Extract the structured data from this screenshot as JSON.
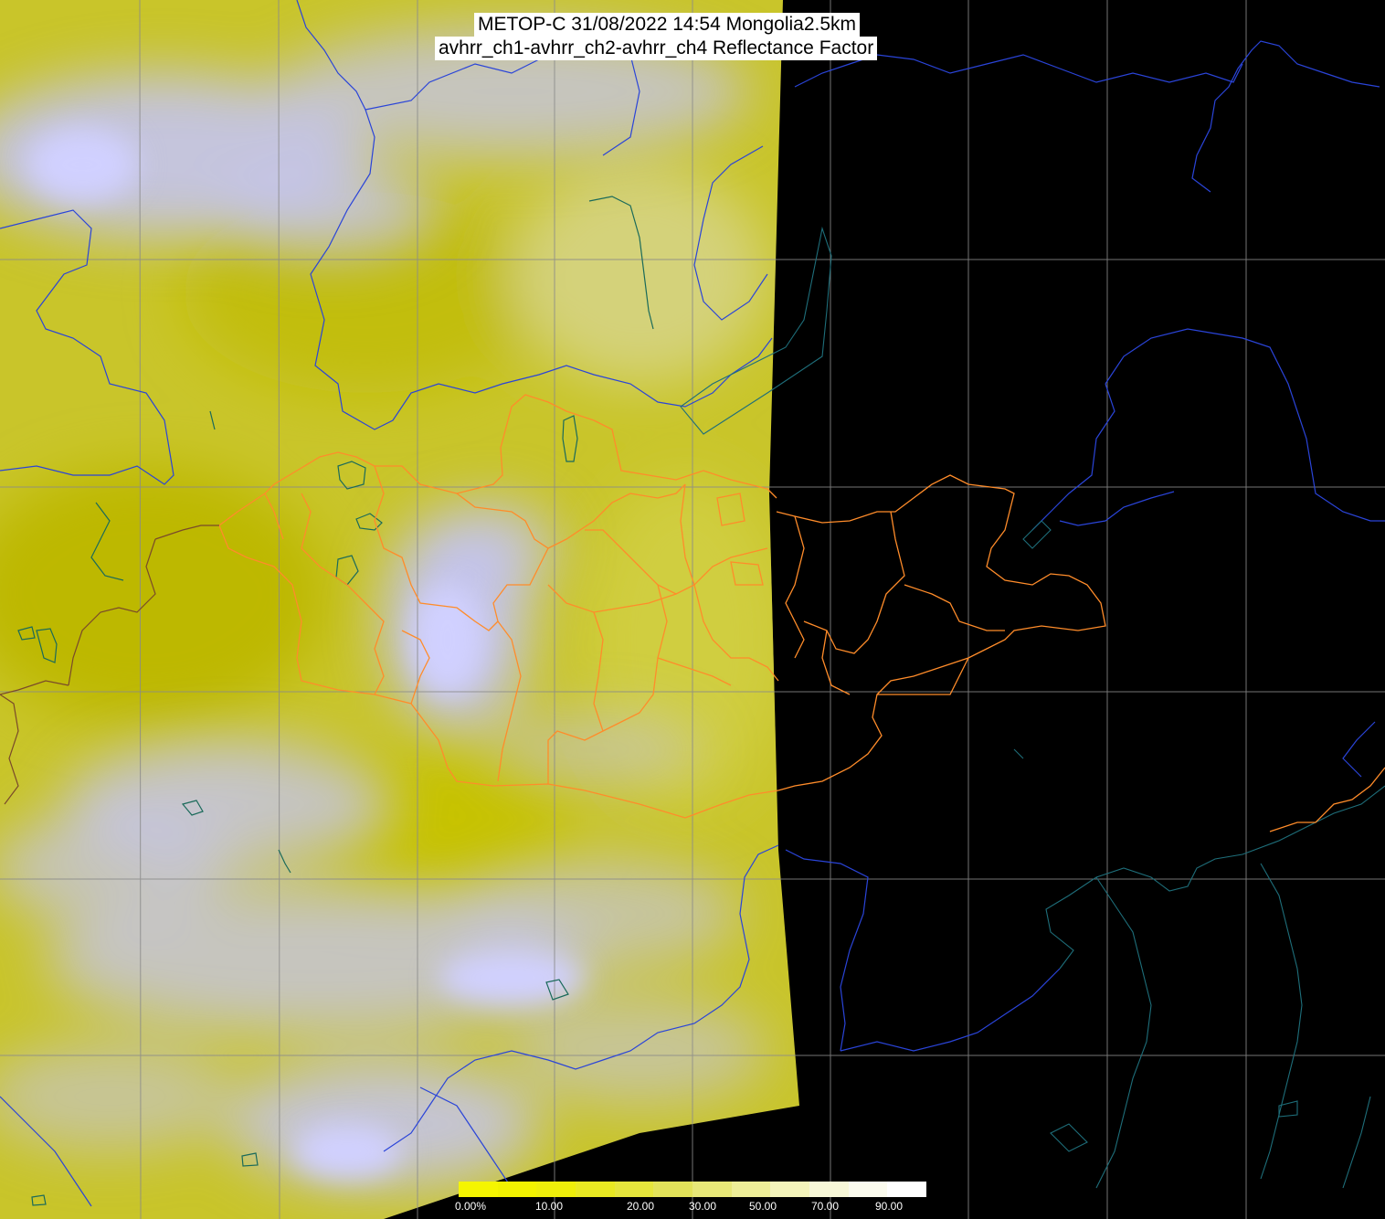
{
  "header": {
    "line1": "METOP-C 31/08/2022 14:54 Mongolia2.5km",
    "line2": "avhrr_ch1-avhrr_ch2-avhrr_ch4 Reflectance Factor"
  },
  "colorbar": {
    "colors": [
      "#f5f500",
      "#f2f200",
      "#eeee0a",
      "#e9e922",
      "#e6e63c",
      "#e3e35a",
      "#e8e878",
      "#eeee98",
      "#f4f4bb",
      "#f8f8d8",
      "#fbfbee",
      "#ffffff"
    ],
    "labels": [
      "0.00%",
      "10.00",
      "20.00",
      "30.00",
      "50.00",
      "70.00",
      "90.00"
    ]
  },
  "colors": {
    "land_yellow": "#c8c400",
    "cloud_lavender": "#c4c4f4",
    "border_orange": "#ff8c2a",
    "river_blue": "#2840d0",
    "lake_teal": "#1a6a6a",
    "grid_gray": "#808080",
    "night": "#000000"
  }
}
